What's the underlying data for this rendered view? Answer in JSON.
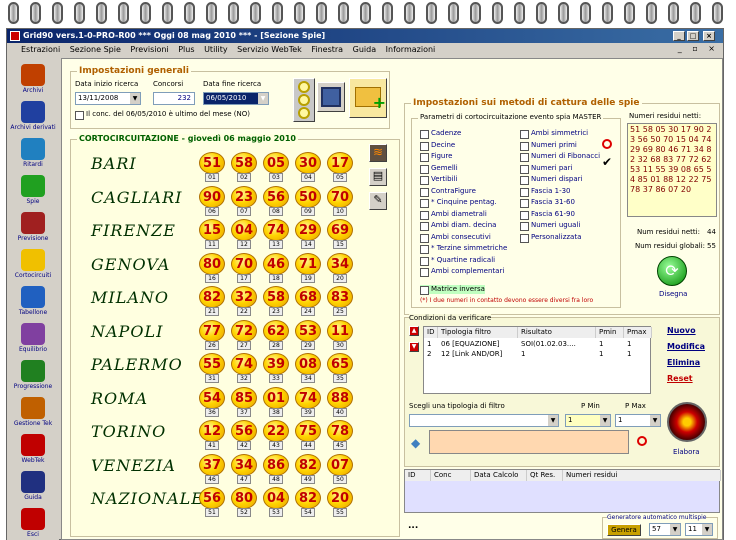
{
  "window": {
    "title": "Grid90 vers.1-0-PRO-R00  ***  Oggi 08 mag 2010  ***  - [Sezione Spie]"
  },
  "menu": [
    "Estrazioni",
    "Sezione Spie",
    "Previsioni",
    "Plus",
    "Utility",
    "Servizio WebTek",
    "Finestra",
    "Guida",
    "Informazioni"
  ],
  "sidebar": [
    {
      "label": "Archivi",
      "icon": "pencil-icon"
    },
    {
      "label": "Archivi derivati",
      "icon": "book-icon"
    },
    {
      "label": "Ritardi",
      "icon": "clock-icon"
    },
    {
      "label": "Spie",
      "icon": "flashlight-icon"
    },
    {
      "label": "Previsione",
      "icon": "clipboard-icon"
    },
    {
      "label": "Cortocircuiti",
      "icon": "bulb-icon"
    },
    {
      "label": "Tabellone",
      "icon": "table-icon"
    },
    {
      "label": "Equilibrio",
      "icon": "balance-icon"
    },
    {
      "label": "Progressione",
      "icon": "dollar-icon"
    },
    {
      "label": "Gestione Tek",
      "icon": "tools-icon"
    },
    {
      "label": "WebTek",
      "icon": "webtek-icon"
    },
    {
      "label": "Guida",
      "icon": "guide-icon"
    },
    {
      "label": "Esci",
      "icon": "exit-icon"
    }
  ],
  "general": {
    "title": "Impostazioni generali",
    "start_label": "Data inizio ricerca",
    "start_value": "13/11/2008",
    "concorsi_label": "Concorsi",
    "concorsi_value": "232",
    "end_label": "Data fine ricerca",
    "end_value": "06/05/2010",
    "checkbox_label": "Il conc. del 06/05/2010 è ultimo del mese (NO)"
  },
  "short_circuit": {
    "title": "CORTOCIRCUITAZIONE - giovedì 06 maggio 2010",
    "rows": [
      {
        "city": "BARI",
        "nums": [
          "51",
          "58",
          "05",
          "30",
          "17"
        ],
        "pos": [
          "01",
          "02",
          "03",
          "04",
          "05"
        ]
      },
      {
        "city": "CAGLIARI",
        "nums": [
          "90",
          "23",
          "56",
          "50",
          "70"
        ],
        "pos": [
          "06",
          "07",
          "08",
          "09",
          "10"
        ]
      },
      {
        "city": "FIRENZE",
        "nums": [
          "15",
          "04",
          "74",
          "29",
          "69"
        ],
        "pos": [
          "11",
          "12",
          "13",
          "14",
          "15"
        ]
      },
      {
        "city": "GENOVA",
        "nums": [
          "80",
          "70",
          "46",
          "71",
          "34"
        ],
        "pos": [
          "16",
          "17",
          "18",
          "19",
          "20"
        ]
      },
      {
        "city": "MILANO",
        "nums": [
          "82",
          "32",
          "58",
          "68",
          "83"
        ],
        "pos": [
          "21",
          "22",
          "23",
          "24",
          "25"
        ]
      },
      {
        "city": "NAPOLI",
        "nums": [
          "77",
          "72",
          "62",
          "53",
          "11"
        ],
        "pos": [
          "26",
          "27",
          "28",
          "29",
          "30"
        ]
      },
      {
        "city": "PALERMO",
        "nums": [
          "55",
          "74",
          "39",
          "08",
          "65"
        ],
        "pos": [
          "31",
          "32",
          "33",
          "34",
          "35"
        ]
      },
      {
        "city": "ROMA",
        "nums": [
          "54",
          "85",
          "01",
          "74",
          "88"
        ],
        "pos": [
          "36",
          "37",
          "38",
          "39",
          "40"
        ]
      },
      {
        "city": "TORINO",
        "nums": [
          "12",
          "56",
          "22",
          "75",
          "78"
        ],
        "pos": [
          "41",
          "42",
          "43",
          "44",
          "45"
        ]
      },
      {
        "city": "VENEZIA",
        "nums": [
          "37",
          "34",
          "86",
          "82",
          "07"
        ],
        "pos": [
          "46",
          "47",
          "48",
          "49",
          "50"
        ]
      },
      {
        "city": "NAZIONALE",
        "nums": [
          "56",
          "80",
          "04",
          "82",
          "20"
        ],
        "pos": [
          "51",
          "52",
          "53",
          "54",
          "55"
        ]
      }
    ]
  },
  "methods": {
    "title": "Impostazioni sui metodi di cattura delle spie",
    "params_title": "Parametri di cortocircuitazione evento spia MASTER",
    "left_opts": [
      "Cadenze",
      "Decine",
      "Figure",
      "Gemelli",
      "Vertibili",
      "ContraFigure",
      "* Cinquine pentag.",
      "Ambi diametrali",
      "Ambi diam. decina",
      "Ambi consecutivi",
      "* Terzine simmetriche",
      "* Quartine radicali",
      "Ambi complementari"
    ],
    "right_opts": [
      "Ambi simmetrici",
      "Numeri primi",
      "Numeri di Fibonacci",
      "Numeri pari",
      "Numeri dispari",
      "Fascia 1-30",
      "Fascia 31-60",
      "Fascia 61-90",
      "Numeri uguali",
      "Personalizzata"
    ],
    "matrix_label": "Matrice inversa",
    "note": "(*) I due numeri in contatto devono essere diversi fra loro"
  },
  "residual": {
    "title": "Numeri residui netti:",
    "numbers": "51 58 05 30 17 90 23 56 50 70 15 04 74 29 69 80 46 71 34 82 32 68 83 77 72 62 53 11 55 39 08 65 54 85 01 88 12 22 75 78 37 86 07 20",
    "net_label": "Num residui netti:",
    "net_value": "44",
    "global_label": "Num residui globali:",
    "global_value": "55",
    "draw_label": "Disegna"
  },
  "conditions": {
    "title": "Condizioni da verificare",
    "headers": [
      "ID",
      "Tipologia filtro",
      "Risultato",
      "Pmin",
      "Pmax"
    ],
    "rows": [
      [
        "1",
        "06 [EQUAZIONE]",
        "SOI(01.02.03....",
        "1",
        "1"
      ],
      [
        "2",
        "12 [Link AND/OR]",
        "1",
        "1",
        "1"
      ]
    ],
    "links": [
      "Nuovo",
      "Modifica",
      "Elimina",
      "Reset"
    ],
    "filter_label": "Scegli una tipologia di filtro",
    "pmin_label": "P Min",
    "pmax_label": "P Max",
    "pmin_value": "1",
    "pmax_value": "1",
    "elabora_label": "Elabora"
  },
  "results": {
    "headers": [
      "ID",
      "Conc",
      "Data Calcolo",
      "Qt Res.",
      "Numeri residui"
    ],
    "status": "...",
    "gen_title": "Generatore automatico multispie",
    "gen_button": "Genera",
    "gen_val1": "57",
    "gen_val2": "11"
  }
}
